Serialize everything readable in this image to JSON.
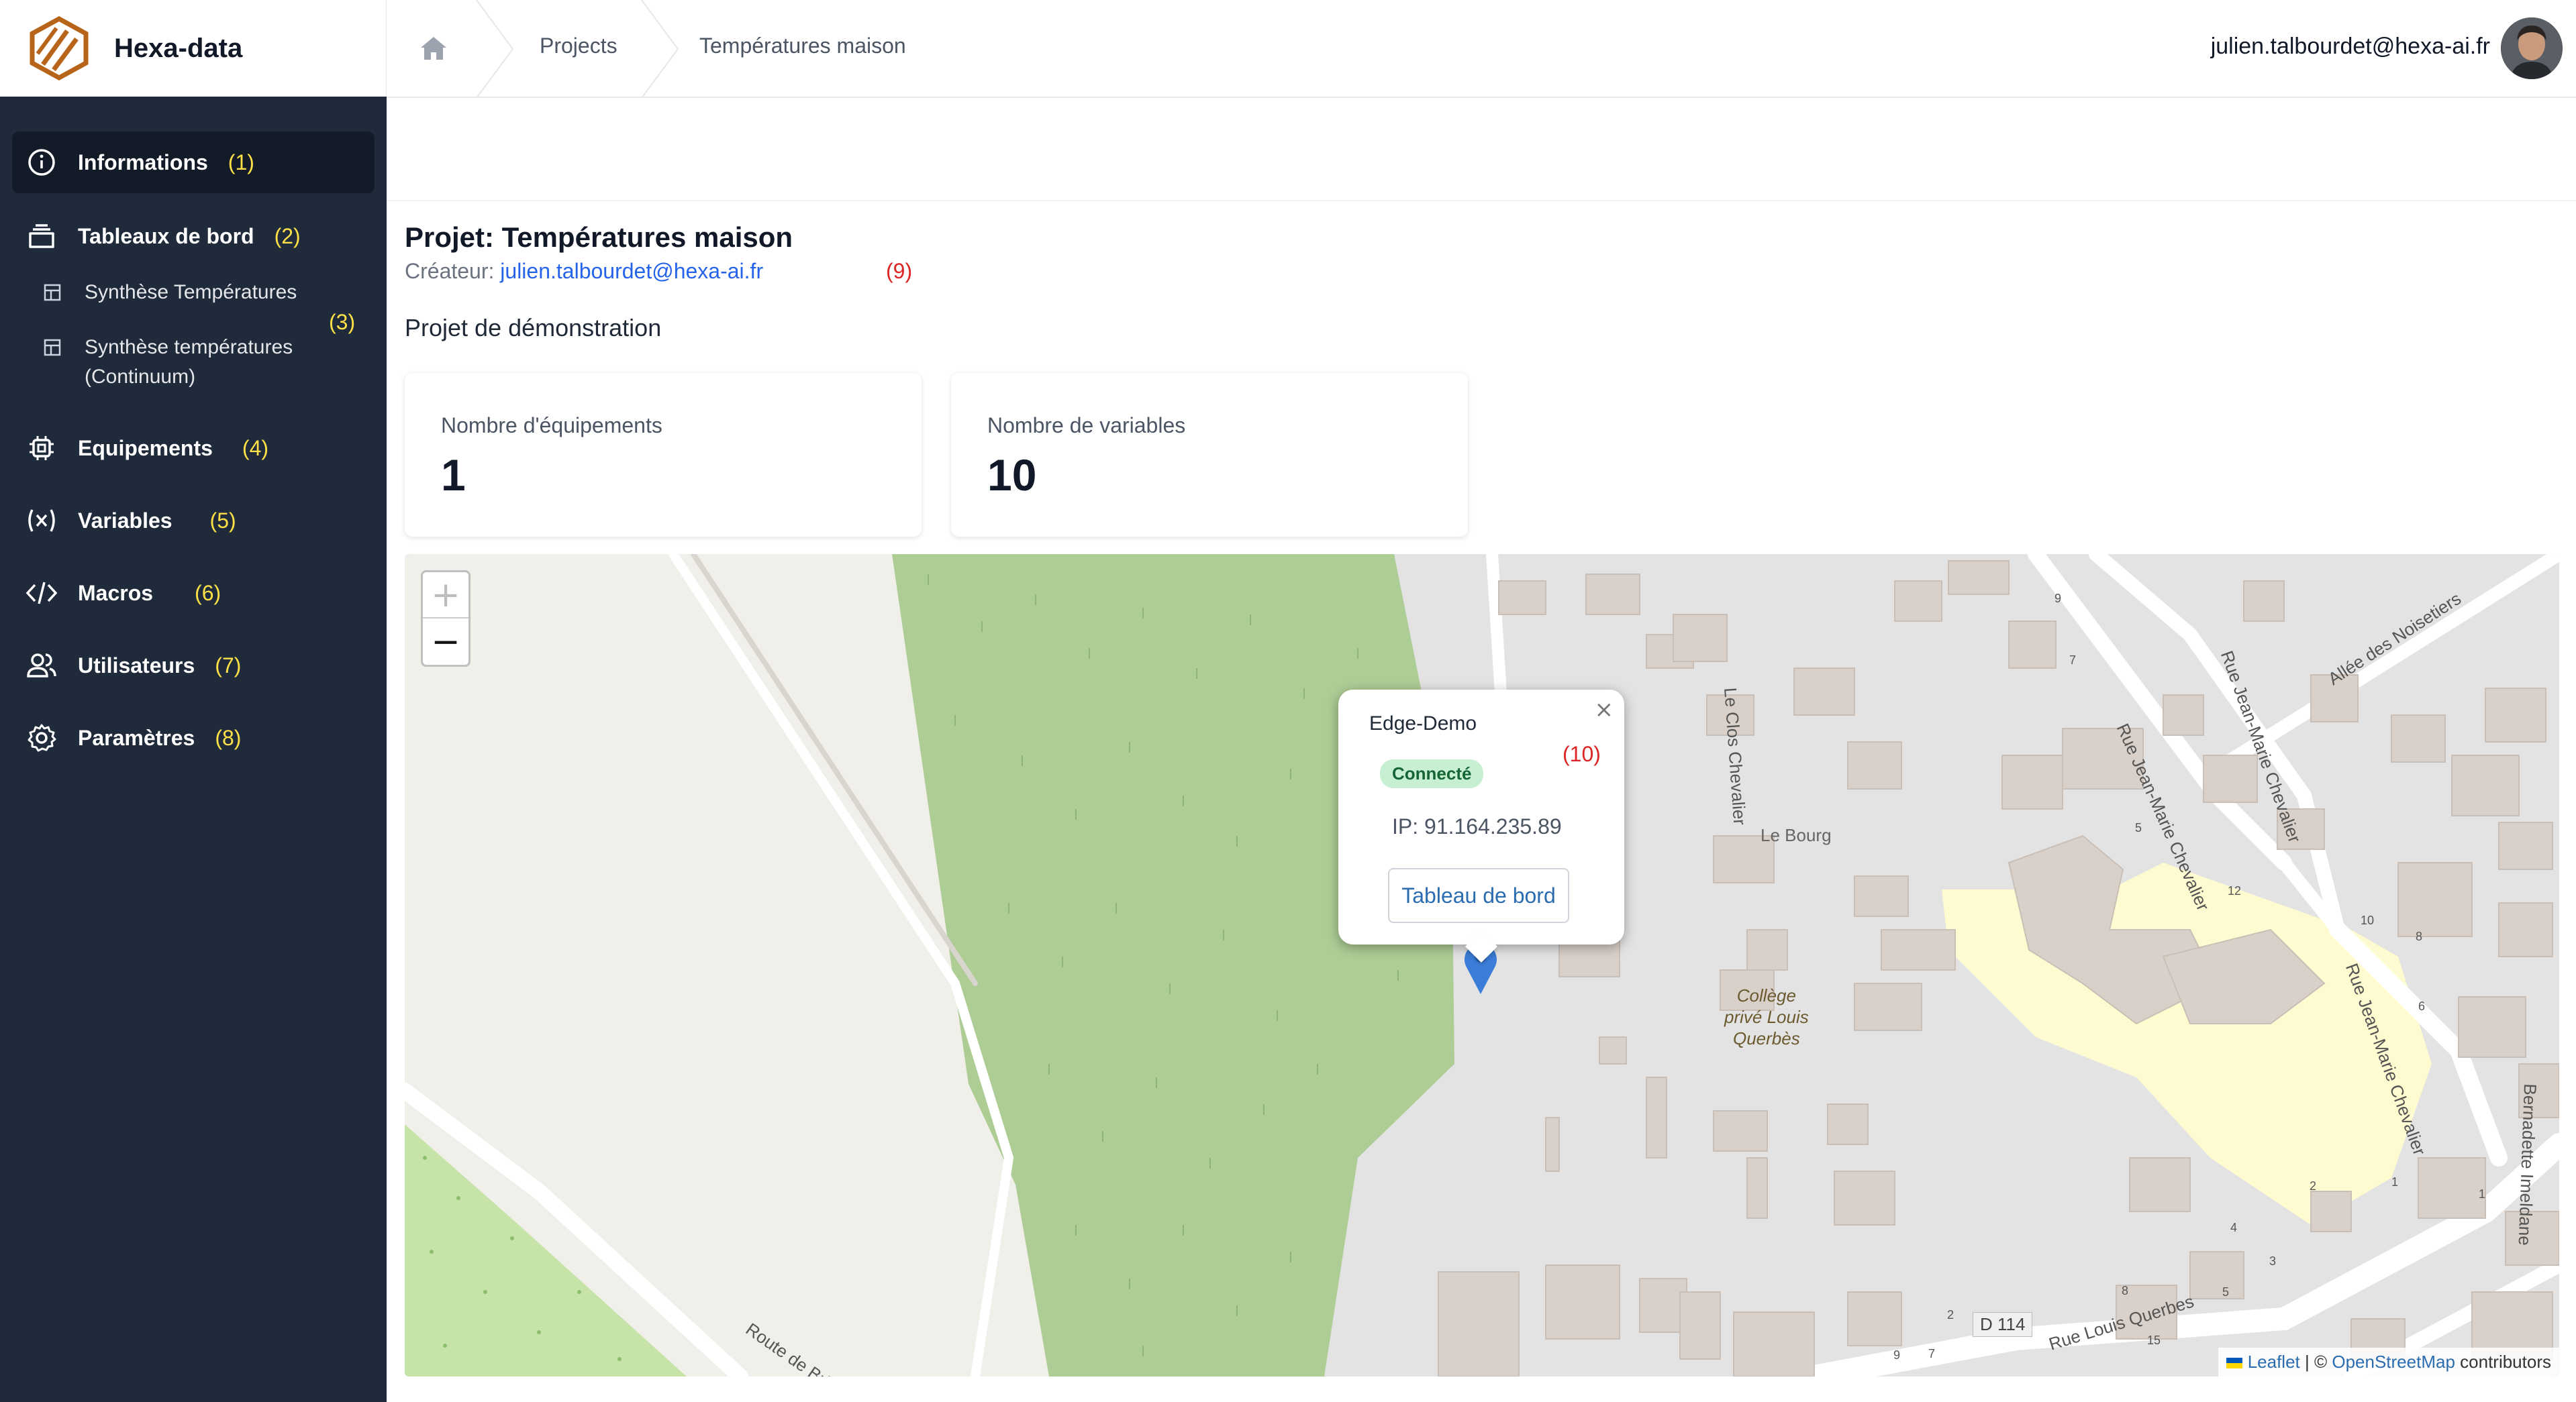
{
  "brand": {
    "name": "Hexa-data"
  },
  "sidebar": {
    "items": [
      {
        "label": "Informations",
        "num": "(1)"
      },
      {
        "label": "Tableaux de bord",
        "num": "(2)"
      },
      {
        "label": "Equipements",
        "num": "(4)"
      },
      {
        "label": "Variables",
        "num": "(5)"
      },
      {
        "label": "Macros",
        "num": "(6)"
      },
      {
        "label": "Utilisateurs",
        "num": "(7)"
      },
      {
        "label": "Paramètres",
        "num": "(8)"
      }
    ],
    "sub_items": [
      {
        "label": "Synthèse Températures"
      },
      {
        "label": "Synthèse températures (Continuum)"
      }
    ],
    "sub_anno": "(3)"
  },
  "header": {
    "breadcrumbs": [
      "Projects",
      "Températures maison"
    ],
    "user_email": "julien.talbourdet@hexa-ai.fr"
  },
  "project": {
    "title": "Projet: Températures maison",
    "creator_label": "Créateur:",
    "creator_email": "julien.talbourdet@hexa-ai.fr",
    "anno": "(9)",
    "description": "Projet de démonstration"
  },
  "stats": [
    {
      "label": "Nombre d'équipements",
      "value": "1"
    },
    {
      "label": "Nombre de variables",
      "value": "10"
    }
  ],
  "map": {
    "zoom_in": "+",
    "zoom_out": "−",
    "popup": {
      "title": "Edge-Demo",
      "anno": "(10)",
      "status": "Connecté",
      "ip": "IP: 91.164.235.89",
      "button": "Tableau de bord",
      "close": "×"
    },
    "streets": {
      "clos": "Le Clos Chevalier",
      "bourg": "Le Bourg",
      "allee": "Allée des Noisetiers",
      "jm1": "Rue Jean-Marie Chevalier",
      "jm2": "Rue Jean-Marie Chevalier",
      "jm3": "Rue Jean-Marie Chevalier",
      "brignais": "Route de Brignais",
      "querbes": "Rue Louis Querbes",
      "bernadette": "Bernadette Imeldane",
      "d114": "D 114"
    },
    "college": [
      "Collège",
      "privé Louis",
      "Querbès"
    ],
    "house_numbers": [
      "9",
      "7",
      "5",
      "12",
      "10",
      "8",
      "6",
      "4",
      "3",
      "2",
      "1",
      "1",
      "15",
      "8",
      "5",
      "2",
      "9",
      "7"
    ],
    "attribution": {
      "leaflet": "Leaflet",
      "sep": " | © ",
      "osm": "OpenStreetMap",
      "contrib": " contributors"
    }
  },
  "colors": {
    "sidebar_bg": "#1f2a3a",
    "accent_yellow": "#fde047",
    "anno_red": "#dc2626",
    "link_blue": "#2563eb",
    "forest_green": "#aecd95",
    "school_yellow": "#fffbd0",
    "building": "#d9d0c9"
  }
}
